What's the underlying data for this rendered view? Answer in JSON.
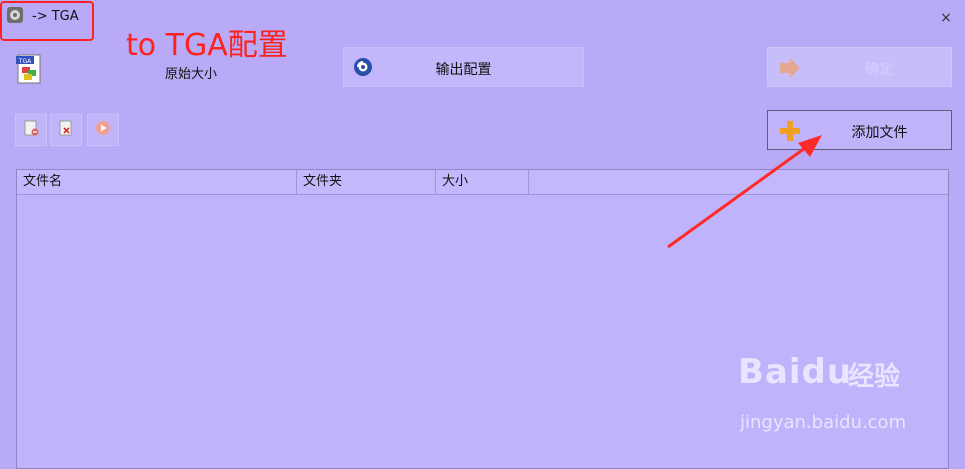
{
  "window": {
    "title": "-> TGA",
    "close_symbol": "×",
    "icon": "app-gear-icon"
  },
  "annotation": {
    "text": "to TGA配置",
    "color": "#ff2020"
  },
  "format": {
    "icon": "tga-file-icon",
    "icon_text": "TGA",
    "size_label": "原始大小"
  },
  "toolbar": {
    "output_label": "输出配置",
    "output_icon": "settings-icon",
    "start_label": "确定",
    "start_icon": "start-arrow-icon",
    "add_label": "添加文件",
    "add_icon": "plus-icon",
    "remove_icon": "remove-file-icon",
    "clear_icon": "clear-list-icon",
    "play_icon": "play-icon"
  },
  "file_list": {
    "columns": [
      "文件名",
      "文件夹",
      "大小"
    ],
    "rows": []
  },
  "watermark": {
    "brand": "Baidu",
    "product": "经验",
    "url": "jingyan.baidu.com"
  },
  "colors": {
    "background": "#b9aaf7",
    "highlight": "#ff2222"
  }
}
